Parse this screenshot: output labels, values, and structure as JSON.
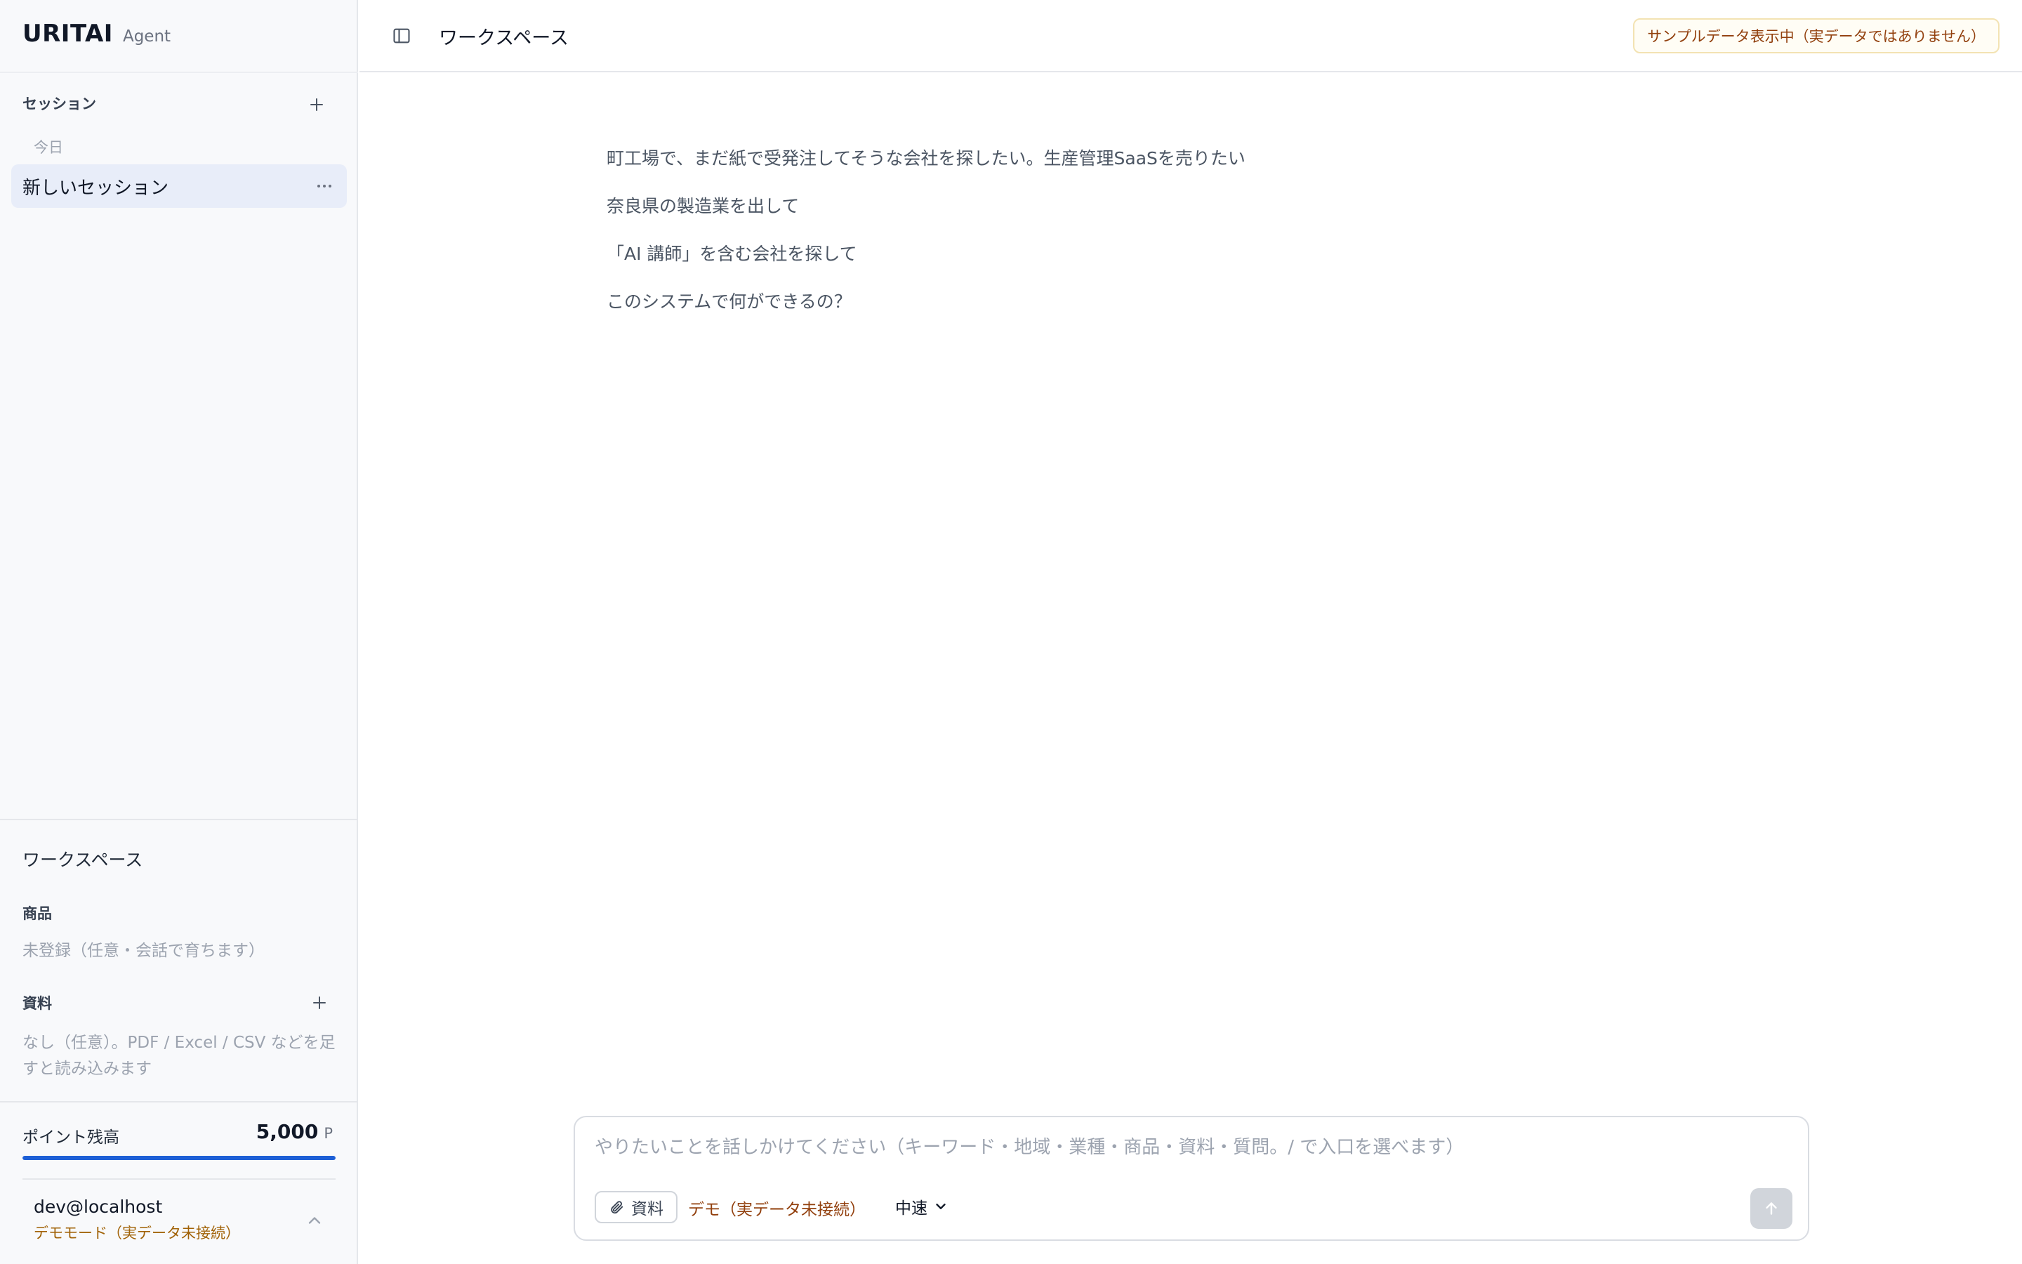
{
  "app": {
    "brand": "URITAI",
    "brand_sub": "Agent"
  },
  "header": {
    "title": "ワークスペース",
    "sample_badge": "サンプルデータ表示中（実データではありません）"
  },
  "sidebar": {
    "sessions_title": "セッション",
    "group_label": "今日",
    "sessions": [
      {
        "label": "新しいセッション"
      }
    ],
    "workspace_title": "ワークスペース",
    "product_title": "商品",
    "product_empty": "未登録（任意・会話で育ちます）",
    "materials_title": "資料",
    "materials_empty": "なし（任意）。PDF / Excel / CSV などを足すと読み込みます",
    "points_label": "ポイント残高",
    "points_value": "5,000",
    "points_unit": "P",
    "points_fill_fraction": 1.0,
    "user_email": "dev@localhost",
    "user_mode": "デモモード（実データ未接続）"
  },
  "suggestions": [
    "町工場で、まだ紙で受発注してそうな会社を探したい。生産管理SaaSを売りたい",
    "奈良県の製造業を出して",
    "「AI 講師」を含む会社を探して",
    "このシステムで何ができるの？"
  ],
  "composer": {
    "placeholder": "やりたいことを話しかけてください（キーワード・地域・業種・商品・資料・質問。/ で入口を選べます）",
    "value": "",
    "attach_label": "資料",
    "demo_status": "デモ（実データ未接続）",
    "speed_label": "中速"
  },
  "colors": {
    "accent": "#1d5fd6",
    "warning_text": "#92400e",
    "selected_bg": "#e8edf9"
  },
  "icons": {
    "sidebar_toggle": "panel-left-icon",
    "add": "plus-icon",
    "more": "ellipsis-icon",
    "attach": "paperclip-icon",
    "dropdown": "chevron-down-icon",
    "send": "arrow-up-icon",
    "user_menu": "chevron-up-icon"
  }
}
